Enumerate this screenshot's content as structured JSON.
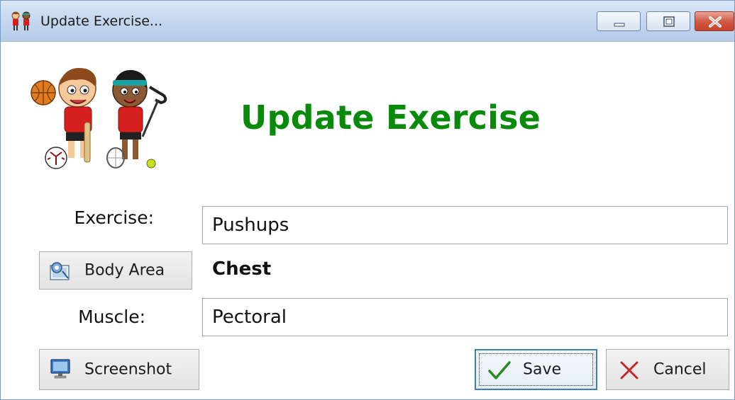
{
  "window": {
    "title": "Update Exercise...",
    "controls": {
      "minimize": "minimize",
      "maximize": "maximize",
      "close": "close"
    }
  },
  "header": {
    "title": "Update Exercise"
  },
  "form": {
    "exercise_label": "Exercise:",
    "exercise_value": "Pushups",
    "body_area_button": "Body Area",
    "body_area_value": "Chest",
    "muscle_label": "Muscle:",
    "muscle_value": "Pectoral"
  },
  "buttons": {
    "screenshot": "Screenshot",
    "save": "Save",
    "cancel": "Cancel"
  },
  "colors": {
    "heading": "#0a8a0a",
    "titlebar": "#c3d6ee",
    "close_button": "#d25b45",
    "save_border": "#3c7fb1"
  },
  "icons": [
    "app-kids-icon",
    "minimize-icon",
    "maximize-icon",
    "close-icon",
    "body-map-icon",
    "monitor-icon",
    "checkmark-icon",
    "x-icon"
  ]
}
